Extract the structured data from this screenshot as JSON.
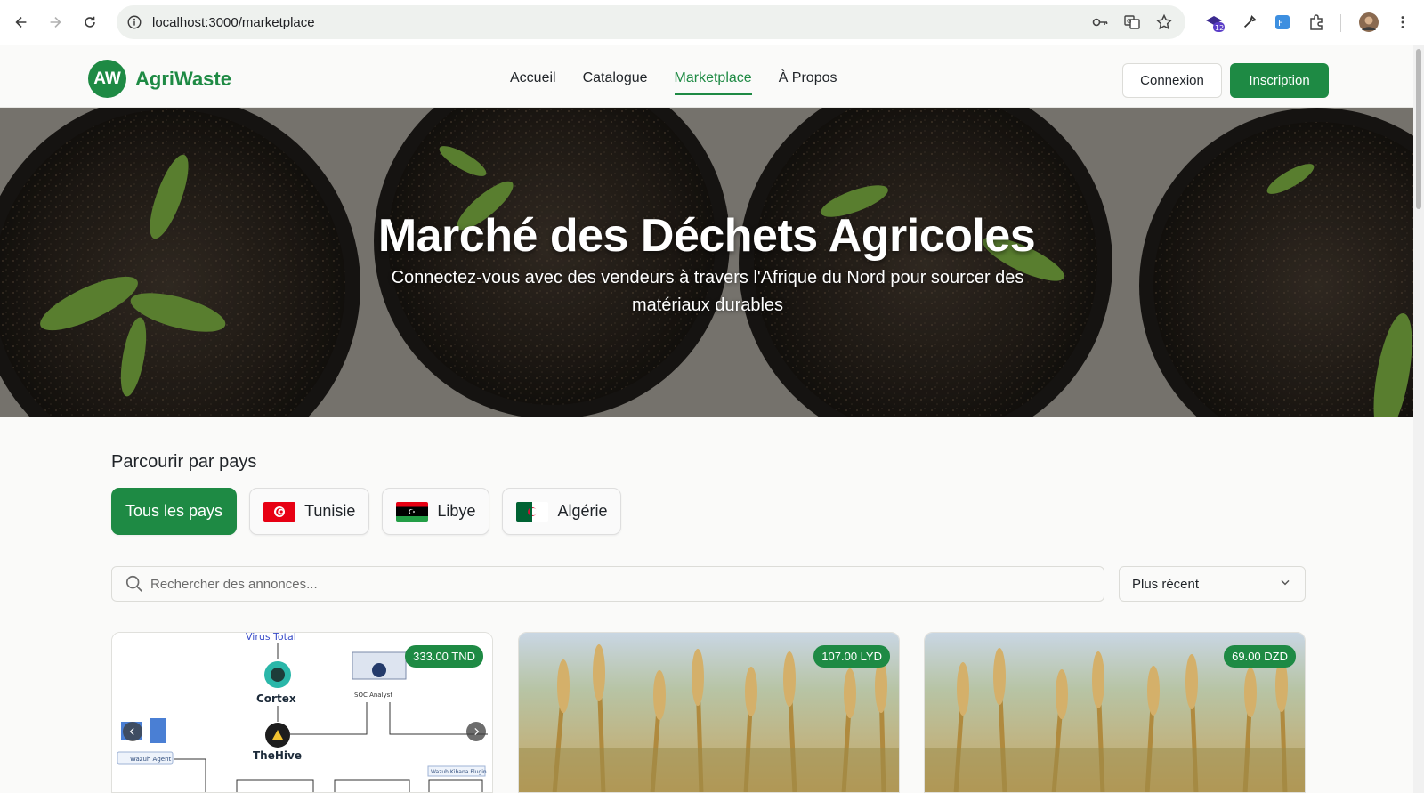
{
  "browser": {
    "url": "localhost:3000/marketplace",
    "notification_count": "12"
  },
  "site": {
    "logo_initials": "AW",
    "logo_name": "AgriWaste",
    "nav": [
      {
        "label": "Accueil",
        "active": false
      },
      {
        "label": "Catalogue",
        "active": false
      },
      {
        "label": "Marketplace",
        "active": true
      },
      {
        "label": "À Propos",
        "active": false
      }
    ],
    "login_label": "Connexion",
    "signup_label": "Inscription",
    "brand_color": "#1e8a44"
  },
  "hero": {
    "title": "Marché des Déchets Agricoles",
    "subtitle": "Connectez-vous avec des vendeurs à travers l'Afrique du Nord pour sourcer des matériaux durables"
  },
  "browse": {
    "title": "Parcourir par pays",
    "countries": [
      {
        "label": "Tous les pays",
        "active": true,
        "flag": null
      },
      {
        "label": "Tunisie",
        "active": false,
        "flag": "tunisia-flag"
      },
      {
        "label": "Libye",
        "active": false,
        "flag": "libya-flag"
      },
      {
        "label": "Algérie",
        "active": false,
        "flag": "algeria-flag"
      }
    ]
  },
  "search": {
    "placeholder": "Rechercher des annonces...",
    "value": ""
  },
  "sort": {
    "selected": "Plus récent"
  },
  "listings": [
    {
      "price": "333.00 TND",
      "diagram_labels": [
        "Virus Total",
        "Cortex",
        "SOC Analyst",
        "TheHive",
        "Wazuh Agent",
        "Wazuh Kibana Plugin"
      ]
    },
    {
      "price": "107.00 LYD"
    },
    {
      "price": "69.00 DZD"
    }
  ]
}
